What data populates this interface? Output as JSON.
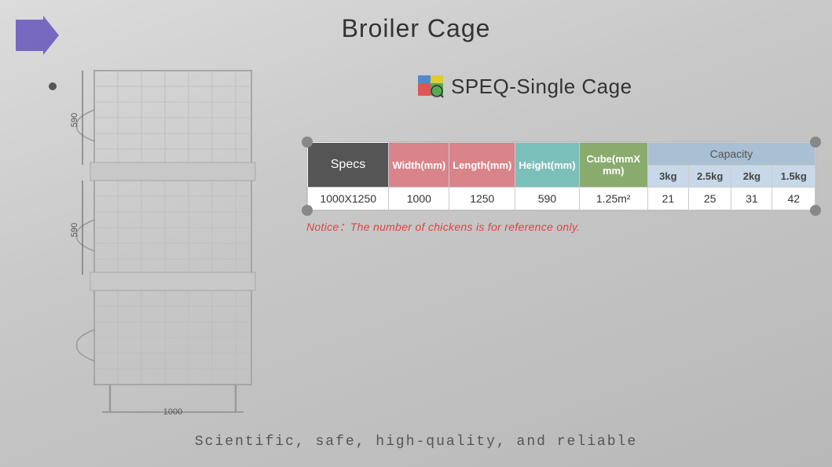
{
  "page": {
    "title": "Broiler Cage",
    "tagline": "Scientific, safe, high-quality, and reliable"
  },
  "speq": {
    "label": "SPEQ-Single Cage"
  },
  "notice": {
    "text": "Notice：The number of chickens is for reference only."
  },
  "table": {
    "headers_row1": {
      "specs": "Specs",
      "width": "Width(mm)",
      "length": "Length(mm)",
      "height": "Height(mm)",
      "cube": "Cube(mmX mm)",
      "capacity": "Capacity"
    },
    "headers_row2": {
      "c3kg": "3kg",
      "c25kg": "2.5kg",
      "c2kg": "2kg",
      "c15kg": "1.5kg"
    },
    "data_row": {
      "specs": "1000X1250",
      "width": "1000",
      "length": "1250",
      "height": "590",
      "cube": "1.25m²",
      "c3kg": "21",
      "c25kg": "25",
      "c2kg": "31",
      "c15kg": "42"
    }
  },
  "diagram": {
    "dim1": "590",
    "dim2": "590",
    "dim3": "1000"
  },
  "icons": {
    "arrow": "▶",
    "bullet": "•"
  }
}
